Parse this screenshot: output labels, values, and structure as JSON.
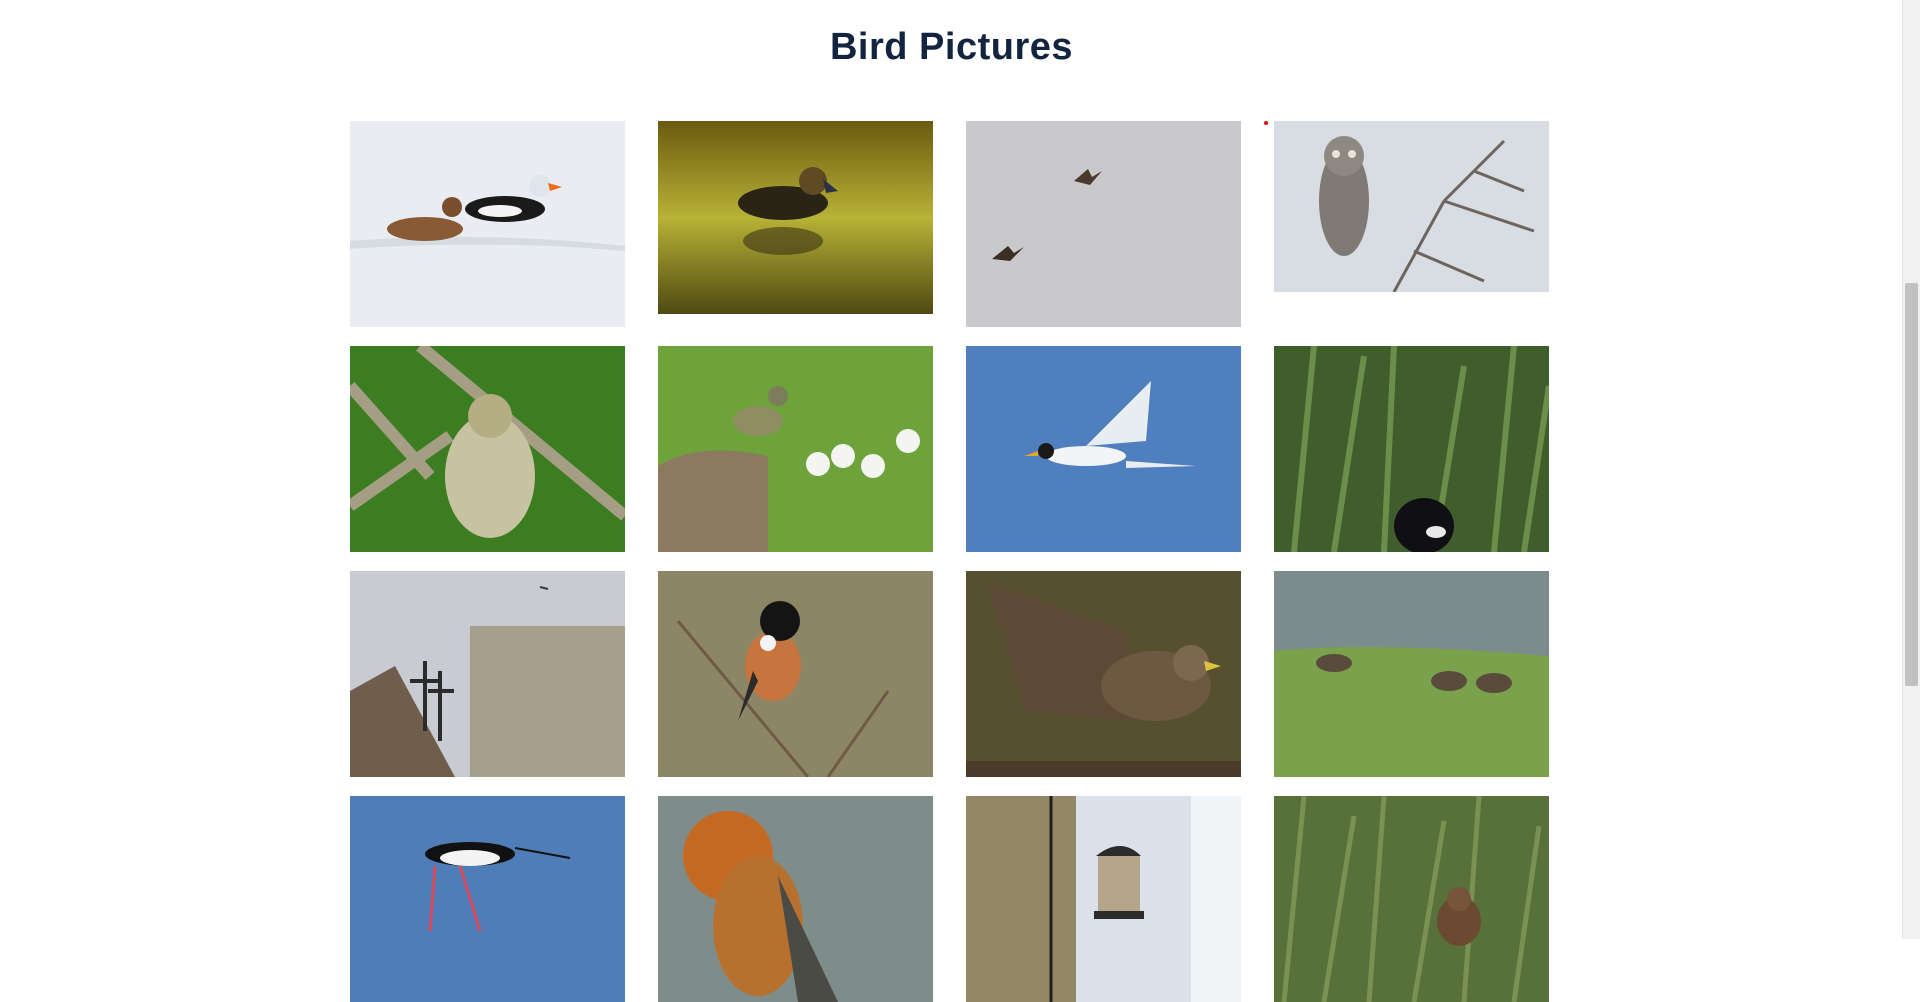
{
  "page": {
    "title": "Bird Pictures"
  },
  "gallery": {
    "images": [
      {
        "alt": "king-eider-ducks"
      },
      {
        "alt": "duckling-on-water"
      },
      {
        "alt": "birds-in-flight"
      },
      {
        "alt": "great-grey-owl"
      },
      {
        "alt": "warbler-on-lichen-branch"
      },
      {
        "alt": "yellow-rumped-warbler"
      },
      {
        "alt": "tern-in-flight"
      },
      {
        "alt": "bird-in-grass"
      },
      {
        "alt": "building-with-crosses"
      },
      {
        "alt": "stonechat"
      },
      {
        "alt": "buzzard"
      },
      {
        "alt": "canada-geese"
      },
      {
        "alt": "black-winged-stilt"
      },
      {
        "alt": "orange-headed-bird"
      },
      {
        "alt": "bird-feeder"
      },
      {
        "alt": "groundhog-in-grass"
      }
    ]
  },
  "colors": {
    "title": "#12243f",
    "scroll_thumb": "#c1c1c1"
  }
}
